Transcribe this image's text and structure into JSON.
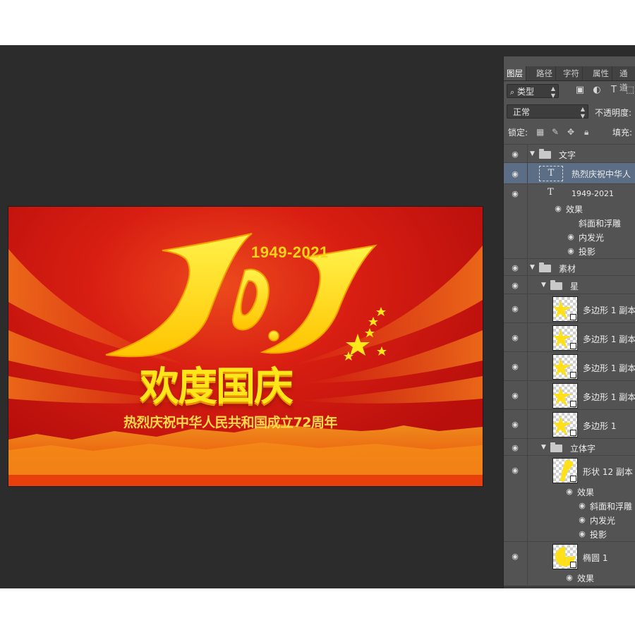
{
  "artwork": {
    "year_range": "1949-2021",
    "headline": "欢度国庆",
    "subline": "热烈庆祝中华人民共和国成立72周年",
    "colors": {
      "red": "#d81e12",
      "yellow": "#ffe61a",
      "orange": "#f07a10"
    }
  },
  "panel": {
    "tabs": [
      "图层",
      "路径",
      "字符",
      "属性",
      "通道"
    ],
    "filter_kind": "类型",
    "blend_mode": "正常",
    "opacity_label": "不透明度:",
    "lock_label": "锁定:",
    "fill_label": "填充:"
  },
  "layers": [
    {
      "type": "group",
      "name": "文字",
      "expanded": true
    },
    {
      "type": "text",
      "name": "热烈庆祝中华人",
      "selected": true
    },
    {
      "type": "text",
      "name": "1949-2021"
    },
    {
      "type": "effects",
      "name": "效果"
    },
    {
      "type": "effect",
      "name": "斜面和浮雕",
      "eye": false
    },
    {
      "type": "effect",
      "name": "内发光",
      "eye": true
    },
    {
      "type": "effect",
      "name": "投影",
      "eye": true
    },
    {
      "type": "group",
      "name": "素材",
      "expanded": true
    },
    {
      "type": "group",
      "name": "星",
      "expanded": true
    },
    {
      "type": "shape",
      "name": "多边形 1 副本"
    },
    {
      "type": "shape",
      "name": "多边形 1 副本"
    },
    {
      "type": "shape",
      "name": "多边形 1 副本"
    },
    {
      "type": "shape",
      "name": "多边形 1 副本"
    },
    {
      "type": "shape",
      "name": "多边形 1"
    },
    {
      "type": "group",
      "name": "立体字",
      "expanded": true
    },
    {
      "type": "shape",
      "name": "形状 12 副本"
    },
    {
      "type": "effects",
      "name": "效果"
    },
    {
      "type": "effect",
      "name": "斜面和浮雕",
      "eye": true
    },
    {
      "type": "effect",
      "name": "内发光",
      "eye": true
    },
    {
      "type": "effect",
      "name": "投影",
      "eye": true
    },
    {
      "type": "shape",
      "name": "椭圆 1"
    },
    {
      "type": "effects",
      "name": "效果"
    }
  ]
}
